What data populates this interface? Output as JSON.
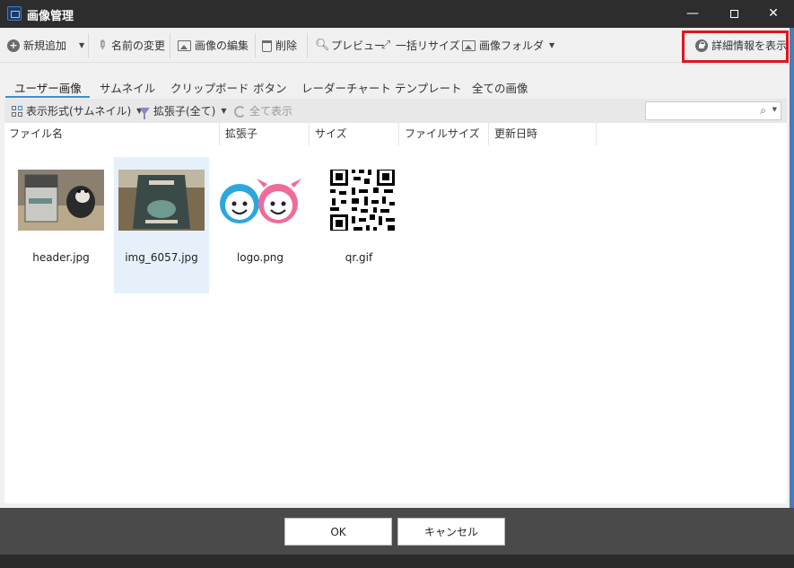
{
  "window": {
    "title": "画像管理",
    "minimize": "—",
    "close": "✕"
  },
  "toolbar": {
    "new_add": "新規追加",
    "rename": "名前の変更",
    "edit_image": "画像の編集",
    "delete": "削除",
    "preview": "プレビュー",
    "batch_resize": "一括リサイズ",
    "image_folder": "画像フォルダ",
    "show_details": "詳細情報を表示"
  },
  "tabs": [
    {
      "label": "ユーザー画像",
      "active": true
    },
    {
      "label": "サムネイル"
    },
    {
      "label": "クリップボード"
    },
    {
      "label": "ボタン"
    },
    {
      "label": "レーダーチャート"
    },
    {
      "label": "テンプレート"
    },
    {
      "label": "全ての画像"
    }
  ],
  "subbar": {
    "display_format": "表示形式(サムネイル)",
    "extension_filter": "拡張子(全て)",
    "show_all": "全て表示",
    "search_value": ""
  },
  "columns": [
    "ファイル名",
    "拡張子",
    "サイズ",
    "ファイルサイズ",
    "更新日時"
  ],
  "files": [
    {
      "name": "header.jpg"
    },
    {
      "name": "img_6057.jpg",
      "selected": true
    },
    {
      "name": "logo.png"
    },
    {
      "name": "qr.gif"
    }
  ],
  "buttons": {
    "ok": "OK",
    "cancel": "キャンセル"
  }
}
